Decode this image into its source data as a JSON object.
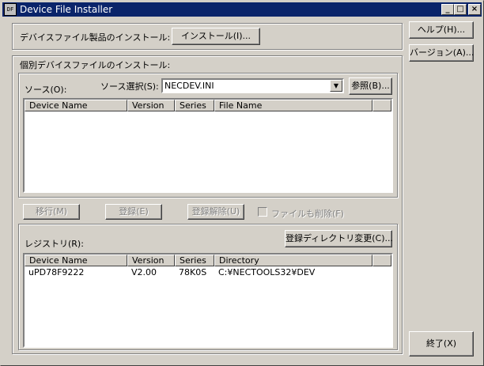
{
  "window": {
    "title": "Device File Installer",
    "icon_text": "DF",
    "controls": {
      "minimize": "_",
      "maximize": "□",
      "close": "×"
    }
  },
  "product_install": {
    "label": "デバイスファイル製品のインストール:",
    "button": "インストール(I)..."
  },
  "side_buttons": {
    "help": "ヘルプ(H)...",
    "version": "バージョン(A)...",
    "exit": "終了(X)"
  },
  "individual": {
    "group_label": "個別デバイスファイルのインストール:",
    "source_label": "ソース(O):",
    "source_select_label": "ソース選択(S):",
    "source_value": "NECDEV.INI",
    "browse_button": "参照(B)...",
    "source_columns": [
      "Device Name",
      "Version",
      "Series",
      "File Name"
    ],
    "source_rows": [],
    "move_button": "移行(M)",
    "register_button": "登録(E)",
    "unregister_button": "登録解除(U)",
    "delete_file_checkbox": "ファイルも削除(F)",
    "delete_file_checked": false,
    "registry_label": "レジストリ(R):",
    "change_dir_button": "登録ディレクトリ変更(C)...",
    "registry_columns": [
      "Device Name",
      "Version",
      "Series",
      "Directory"
    ],
    "registry_rows": [
      [
        "uPD78F9222",
        "V2.00",
        "78K0S",
        "C:¥NECTOOLS32¥DEV"
      ]
    ]
  }
}
